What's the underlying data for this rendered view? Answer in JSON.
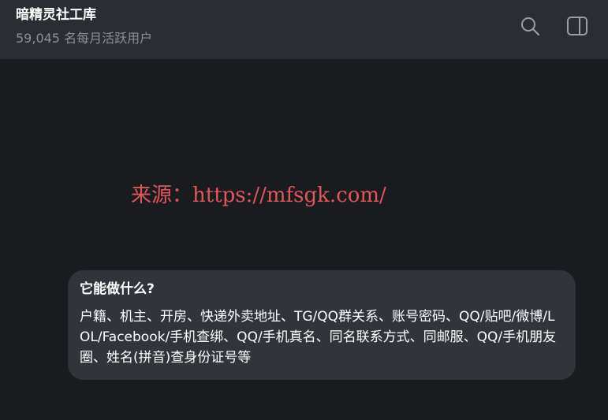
{
  "header": {
    "title": "暗精灵社工库",
    "subtitle": "59,045 名每月活跃用户",
    "search_icon": "search-icon",
    "panel_icon": "sidebar-panel-icon"
  },
  "watermark": {
    "text": "来源：https://mfsgk.com/",
    "color": "#e0575b"
  },
  "message": {
    "title": "它能做什么?",
    "body": "户籍、机主、开房、快递外卖地址、TG/QQ群关系、账号密码、QQ/贴吧/微博/LOL/Facebook/手机查绑、QQ/手机真名、同名联系方式、同邮服、QQ/手机朋友圈、姓名(拼音)查身份证号等"
  },
  "colors": {
    "background": "#1a1b1f",
    "header": "#2a2e34",
    "bubble": "#31353b",
    "muted_text": "#8c9096"
  }
}
